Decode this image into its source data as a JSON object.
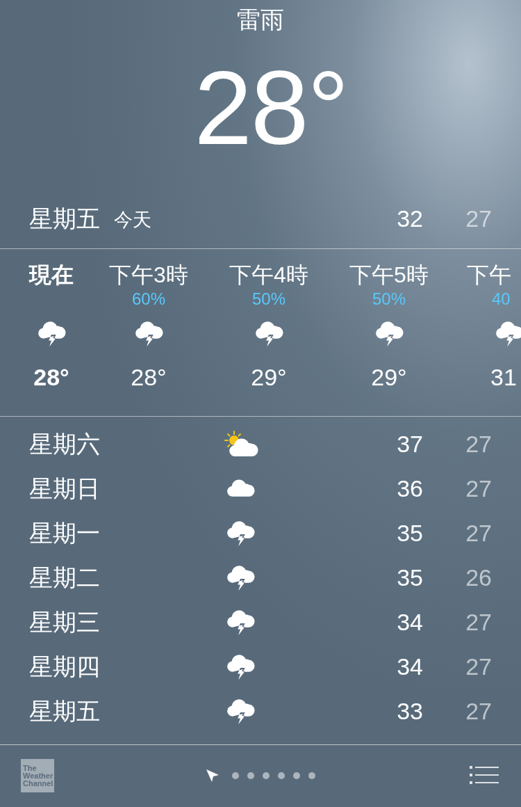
{
  "current": {
    "condition": "雷雨",
    "temperature": "28°"
  },
  "today": {
    "day": "星期五",
    "label": "今天",
    "high": "32",
    "low": "27"
  },
  "hourly": [
    {
      "time": "現在",
      "now": true,
      "kind": "thunderstorm",
      "temp": "28°"
    },
    {
      "time": "下午3時",
      "now": false,
      "chance": "60%",
      "kind": "thunderstorm",
      "temp": "28°"
    },
    {
      "time": "下午4時",
      "now": false,
      "chance": "50%",
      "kind": "thunderstorm",
      "temp": "29°"
    },
    {
      "time": "下午5時",
      "now": false,
      "chance": "50%",
      "kind": "thunderstorm",
      "temp": "29°"
    },
    {
      "time": "下午",
      "now": false,
      "chance": "40",
      "kind": "thunderstorm",
      "temp": "31"
    }
  ],
  "daily": [
    {
      "day": "星期六",
      "kind": "partly-sunny",
      "high": "37",
      "low": "27"
    },
    {
      "day": "星期日",
      "kind": "cloudy",
      "high": "36",
      "low": "27"
    },
    {
      "day": "星期一",
      "kind": "thunderstorm",
      "high": "35",
      "low": "27"
    },
    {
      "day": "星期二",
      "kind": "thunderstorm",
      "high": "35",
      "low": "26"
    },
    {
      "day": "星期三",
      "kind": "thunderstorm",
      "high": "34",
      "low": "27"
    },
    {
      "day": "星期四",
      "kind": "thunderstorm",
      "high": "34",
      "low": "27"
    },
    {
      "day": "星期五",
      "kind": "thunderstorm",
      "high": "33",
      "low": "27"
    }
  ],
  "footer": {
    "logo": [
      "The",
      "Weather",
      "Channel"
    ],
    "pages": [
      {
        "kind": "location",
        "selected": true
      },
      {
        "kind": "dot",
        "selected": false
      },
      {
        "kind": "dot",
        "selected": false
      },
      {
        "kind": "dot",
        "selected": false
      },
      {
        "kind": "dot",
        "selected": false
      },
      {
        "kind": "dot",
        "selected": false
      },
      {
        "kind": "dot",
        "selected": false
      }
    ]
  }
}
